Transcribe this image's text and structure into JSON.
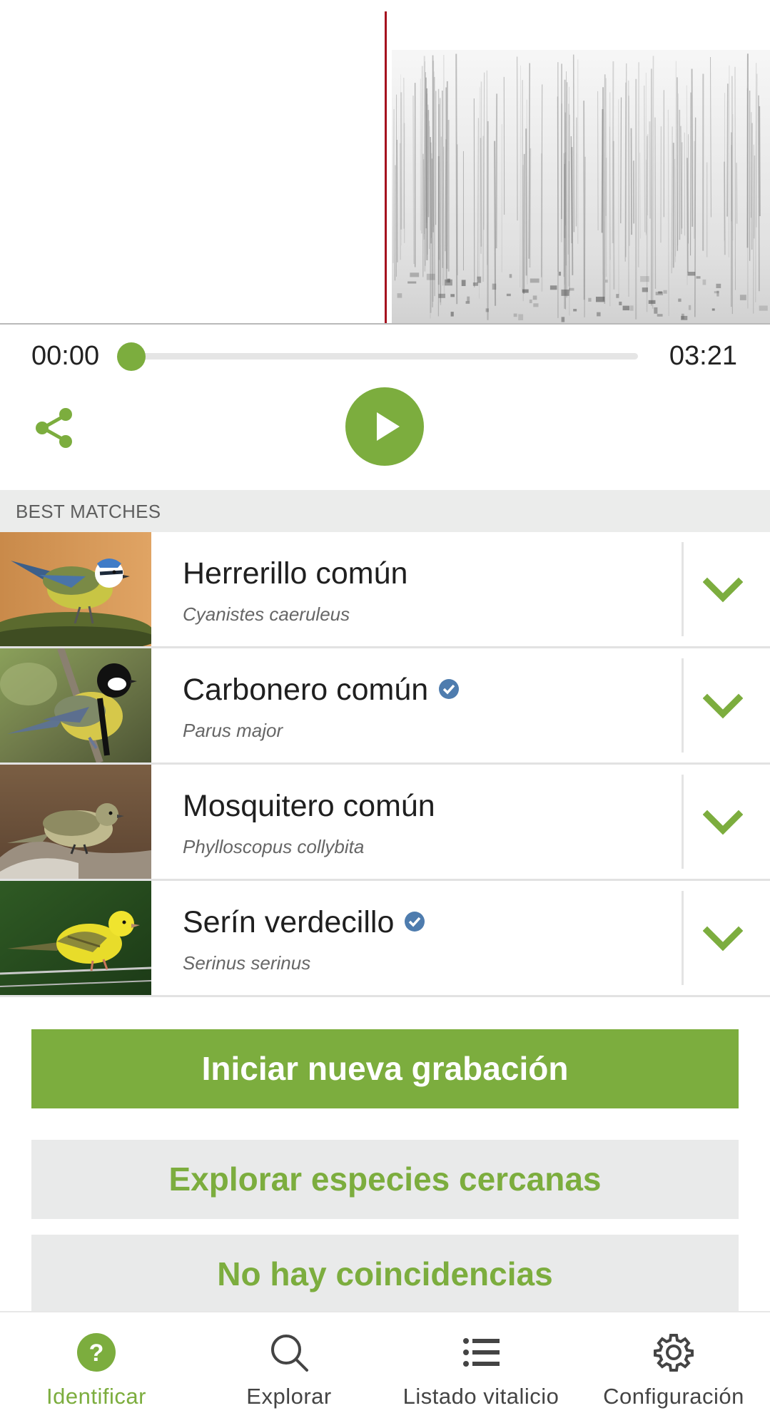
{
  "player": {
    "time_start": "00:00",
    "time_end": "03:21",
    "progress": 0
  },
  "section_header": "BEST MATCHES",
  "matches": [
    {
      "name": "Herrerillo común",
      "scientific": "Cyanistes caeruleus",
      "verified": false
    },
    {
      "name": "Carbonero común",
      "scientific": "Parus major",
      "verified": true
    },
    {
      "name": "Mosquitero común",
      "scientific": "Phylloscopus collybita",
      "verified": false
    },
    {
      "name": "Serín verdecillo",
      "scientific": "Serinus serinus",
      "verified": true
    }
  ],
  "buttons": {
    "new_recording": "Iniciar nueva grabación",
    "explore_nearby": "Explorar especies cercanas",
    "no_match": "No hay coincidencias"
  },
  "nav": [
    {
      "label": "Identificar",
      "icon": "question-icon",
      "active": true
    },
    {
      "label": "Explorar",
      "icon": "search-icon",
      "active": false
    },
    {
      "label": "Listado vitalicio",
      "icon": "list-icon",
      "active": false
    },
    {
      "label": "Configuración",
      "icon": "gear-icon",
      "active": false
    }
  ],
  "colors": {
    "accent": "#7cad3e",
    "playhead": "#a50e1e",
    "verified": "#4e7cae"
  }
}
